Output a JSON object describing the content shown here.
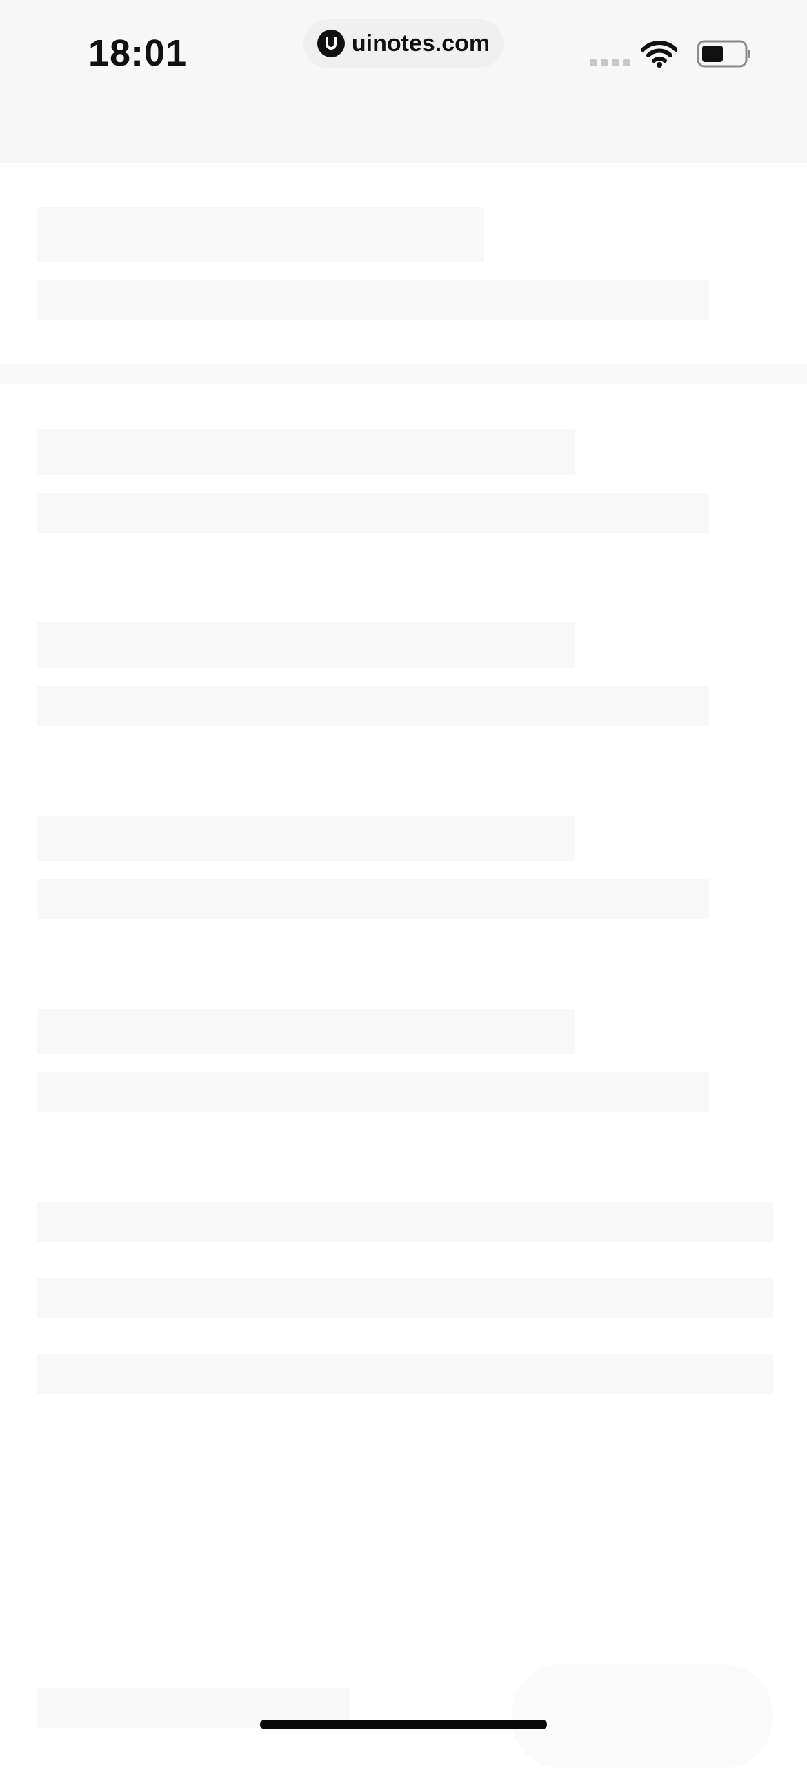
{
  "status_bar": {
    "time": "18:01",
    "url": "uinotes.com",
    "url_logo_letter": "U",
    "icons": [
      "cellular-signal-icon",
      "wifi-icon",
      "battery-icon"
    ],
    "battery_level": 0.45
  },
  "colors": {
    "header_bg": "#f7f7f7",
    "skeleton": "#f8f8f8",
    "home_indicator": "#0a0a0a",
    "text": "#111111"
  },
  "content": {
    "state": "loading-skeleton",
    "skeleton_groups": 6
  }
}
